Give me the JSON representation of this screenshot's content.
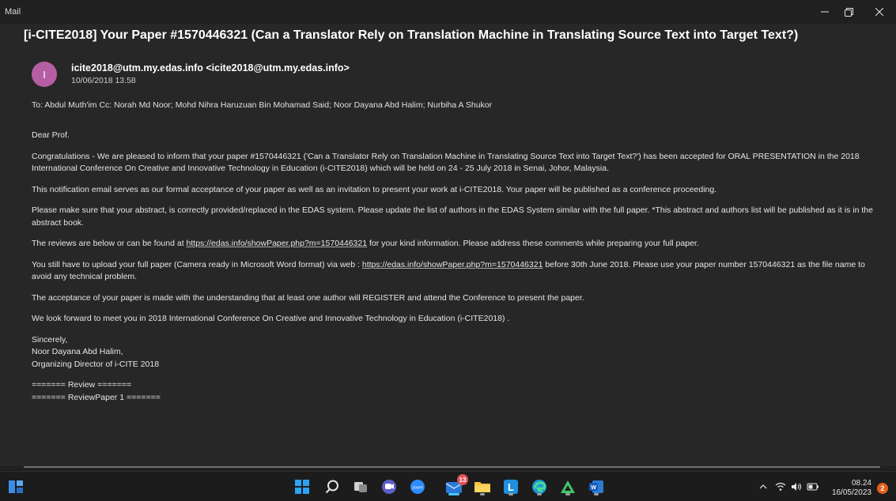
{
  "window": {
    "app_name": "Mail"
  },
  "email": {
    "subject": "[i-CITE2018] Your Paper #1570446321 (Can a Translator Rely on Translation Machine in Translating Source Text into Target Text?)",
    "avatar_letter": "I",
    "sender": "icite2018@utm.my.edas.info <icite2018@utm.my.edas.info>",
    "date": "10/06/2018 13.58",
    "recipients": "To: Abdul Muth'im Cc: Norah Md Noor; Mohd Nihra Haruzuan Bin Mohamad Said; Noor Dayana Abd Halim; Nurbiha A Shukor",
    "greeting": "Dear Prof.",
    "para1": "Congratulations - We are pleased to inform that your paper #1570446321 ('Can a Translator Rely on Translation Machine in Translating Source Text into Target Text?') has been accepted for ORAL PRESENTATION in the 2018 International Conference On Creative and Innovative Technology in Education (i-CITE2018) which will be held on 24 - 25 July 2018 in Senai, Johor, Malaysia.",
    "para2": "This notification email serves as our formal acceptance of your paper as well as an invitation to present your work at i-CITE2018. Your paper will be published as a conference proceeding.",
    "para3": "Please make sure that your abstract, is correctly provided/replaced in the EDAS system. Please update the list of authors in the EDAS System similar with the full paper. *This abstract and authors list will be published as it is in the abstract book.",
    "para4_pre": "The reviews are below or can be found at ",
    "para4_link": "https://edas.info/showPaper.php?m=1570446321",
    "para4_post": " for your kind information. Please address these comments while preparing your full paper.",
    "para5_pre": "You still have to upload your full paper (Camera ready in Microsoft Word format) via web : ",
    "para5_link": "https://edas.info/showPaper.php?m=1570446321",
    "para5_post": " before 30th June 2018. Please use your paper number 1570446321 as the file name to avoid any technical problem.",
    "para6": "The acceptance of your paper is made with the understanding that at least one author will REGISTER and attend the Conference to present the paper.",
    "para7": "We look forward to meet you in 2018 International Conference On Creative and Innovative Technology in Education (i-CITE2018) .",
    "sign_line1": "Sincerely,",
    "sign_line2": "Noor Dayana Abd Halim,",
    "sign_line3": "Organizing Director of i-CITE 2018",
    "review_line1": "======= Review =======",
    "review_line2": "======= ReviewPaper 1 ======="
  },
  "taskbar": {
    "mail_badge": "13",
    "clock_time": "08.24",
    "clock_date": "16/05/2023",
    "notification_count": "2",
    "icons": [
      "windows-start-icon",
      "search-icon",
      "task-view-icon",
      "chat-icon",
      "zoom-icon",
      "mail-icon",
      "file-explorer-icon",
      "learning-app-icon",
      "edge-icon",
      "nvidia-icon",
      "word-icon"
    ]
  },
  "colors": {
    "background": "#202020",
    "pane": "#272727",
    "avatar": "#b55ea4",
    "accent": "#4cc2ff",
    "badge_red": "#e0525a",
    "notification_orange": "#e35d1a"
  }
}
